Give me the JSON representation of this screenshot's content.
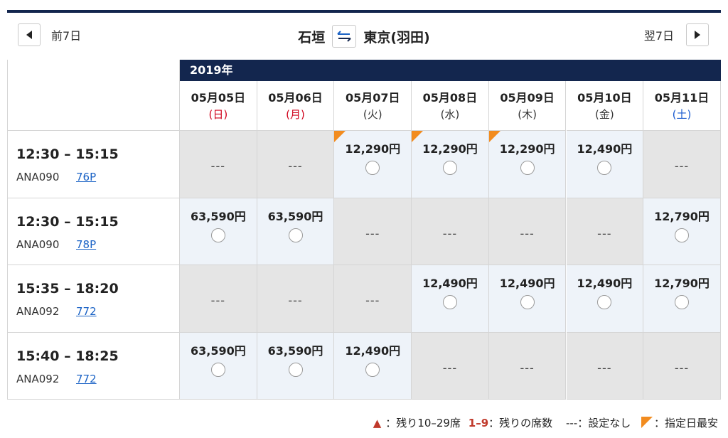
{
  "nav": {
    "prev_label": "前7日",
    "next_label": "翌7日"
  },
  "route": {
    "from": "石垣",
    "to": "東京(羽田)"
  },
  "year": "2019年",
  "days": [
    {
      "date": "05月05日",
      "weekday": "(日)",
      "kind": "sun"
    },
    {
      "date": "05月06日",
      "weekday": "(月)",
      "kind": "hol"
    },
    {
      "date": "05月07日",
      "weekday": "(火)",
      "kind": "wk"
    },
    {
      "date": "05月08日",
      "weekday": "(水)",
      "kind": "wk"
    },
    {
      "date": "05月09日",
      "weekday": "(木)",
      "kind": "wk"
    },
    {
      "date": "05月10日",
      "weekday": "(金)",
      "kind": "wk"
    },
    {
      "date": "05月11日",
      "weekday": "(土)",
      "kind": "sat"
    }
  ],
  "flights": [
    {
      "time": "12:30 – 15:15",
      "flight_no": "ANA090",
      "aircraft": "76P",
      "fares": [
        {
          "price": null
        },
        {
          "price": null
        },
        {
          "price": "12,290円",
          "cheapest": true
        },
        {
          "price": "12,290円",
          "cheapest": true
        },
        {
          "price": "12,290円",
          "cheapest": true
        },
        {
          "price": "12,490円"
        },
        {
          "price": null
        }
      ]
    },
    {
      "time": "12:30 – 15:15",
      "flight_no": "ANA090",
      "aircraft": "78P",
      "fares": [
        {
          "price": "63,590円"
        },
        {
          "price": "63,590円"
        },
        {
          "price": null
        },
        {
          "price": null
        },
        {
          "price": null
        },
        {
          "price": null
        },
        {
          "price": "12,790円"
        }
      ]
    },
    {
      "time": "15:35 – 18:20",
      "flight_no": "ANA092",
      "aircraft": "772",
      "fares": [
        {
          "price": null
        },
        {
          "price": null
        },
        {
          "price": null
        },
        {
          "price": "12,490円"
        },
        {
          "price": "12,490円"
        },
        {
          "price": "12,490円"
        },
        {
          "price": "12,790円"
        }
      ]
    },
    {
      "time": "15:40 – 18:25",
      "flight_no": "ANA092",
      "aircraft": "772",
      "fares": [
        {
          "price": "63,590円"
        },
        {
          "price": "63,590円"
        },
        {
          "price": "12,490円"
        },
        {
          "price": null
        },
        {
          "price": null
        },
        {
          "price": null
        },
        {
          "price": null
        }
      ]
    }
  ],
  "no_fare_text": "---",
  "legend": {
    "triangle": "▲",
    "remaining_10_29": "：残り10–29席",
    "seats_range": "1–9",
    "seats_text": "：残りの席数",
    "dash": "---",
    "dash_text": "：設定なし",
    "cheapest_text": "：指定日最安"
  }
}
